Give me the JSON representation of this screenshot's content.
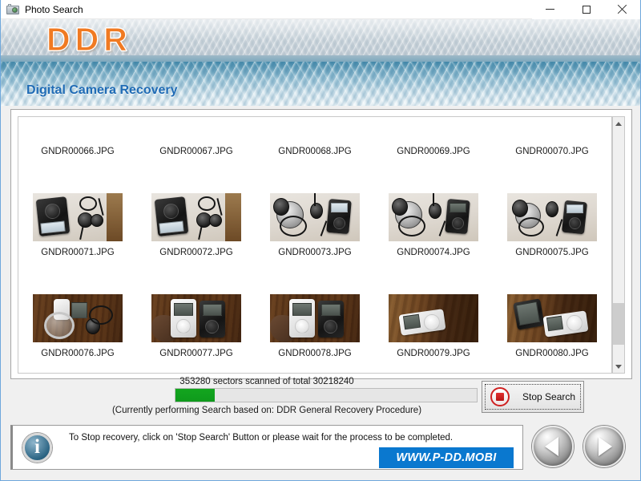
{
  "window": {
    "title": "Photo Search",
    "icon": "camera-icon",
    "minimize_label": "—",
    "maximize_label": "□",
    "close_label": "✕"
  },
  "banner": {
    "logo": "DDR",
    "tagline": "Digital Camera Recovery",
    "logo_color": "#f07a22",
    "tagline_color": "#1f6bb5"
  },
  "thumbnails": {
    "rows": [
      {
        "type": "labels-only",
        "files": [
          "GNDR00066.JPG",
          "GNDR00067.JPG",
          "GNDR00068.JPG",
          "GNDR00069.JPG",
          "GNDR00070.JPG"
        ]
      },
      {
        "type": "images",
        "files": [
          "GNDR00071.JPG",
          "GNDR00072.JPG",
          "GNDR00073.JPG",
          "GNDR00074.JPG",
          "GNDR00075.JPG"
        ]
      },
      {
        "type": "images",
        "files": [
          "GNDR00076.JPG",
          "GNDR00077.JPG",
          "GNDR00078.JPG",
          "GNDR00079.JPG",
          "GNDR00080.JPG"
        ]
      }
    ]
  },
  "progress": {
    "scan_text": "353280 sectors scanned of total 30218240",
    "sectors_scanned": 353280,
    "sectors_total": 30218240,
    "percent": 13,
    "fill_color": "#13a61f",
    "procedure_text": "(Currently performing Search based on:  DDR General Recovery Procedure)",
    "stop_button_label": "Stop Search",
    "stop_icon": "stop-circle-icon"
  },
  "footer": {
    "info_icon": "info-icon",
    "info_text": "To Stop recovery, click on 'Stop Search' Button or please wait for the process to be completed.",
    "website": "WWW.P-DD.MOBI",
    "website_color": "#0a78cf",
    "prev_icon": "previous-arrow-icon",
    "next_icon": "next-arrow-icon"
  },
  "scrollbar": {
    "up_icon": "scroll-up-icon",
    "down_icon": "scroll-down-icon"
  }
}
